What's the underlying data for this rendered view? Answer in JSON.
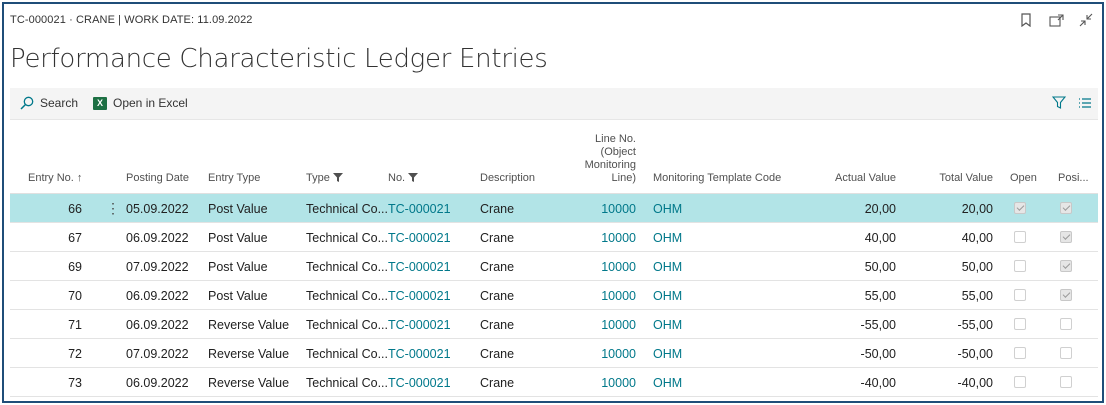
{
  "breadcrumb": "TC-000021 · CRANE | WORK DATE: 11.09.2022",
  "title": "Performance Characteristic Ledger Entries",
  "actions": {
    "search": "Search",
    "excel": "Open in Excel",
    "excel_glyph": "X"
  },
  "columns": {
    "entry_no": "Entry No. ↑",
    "posting_date": "Posting Date",
    "entry_type": "Entry Type",
    "type": "Type",
    "no": "No.",
    "description": "Description",
    "line_no_1": "Line No.",
    "line_no_2": "(Object",
    "line_no_3": "Monitoring",
    "line_no_4": "Line)",
    "template": "Monitoring Template Code",
    "actual": "Actual Value",
    "total": "Total Value",
    "open": "Open",
    "posi": "Posi..."
  },
  "rows": [
    {
      "entry_no": "66",
      "posting_date": "05.09.2022",
      "entry_type": "Post Value",
      "type": "Technical Co...",
      "no": "TC-000021",
      "description": "Crane",
      "line_no": "10000",
      "template": "OHM",
      "actual": "20,00",
      "total": "20,00",
      "open": true,
      "posi": true
    },
    {
      "entry_no": "67",
      "posting_date": "06.09.2022",
      "entry_type": "Post Value",
      "type": "Technical Co...",
      "no": "TC-000021",
      "description": "Crane",
      "line_no": "10000",
      "template": "OHM",
      "actual": "40,00",
      "total": "40,00",
      "open": false,
      "posi": true
    },
    {
      "entry_no": "69",
      "posting_date": "07.09.2022",
      "entry_type": "Post Value",
      "type": "Technical Co...",
      "no": "TC-000021",
      "description": "Crane",
      "line_no": "10000",
      "template": "OHM",
      "actual": "50,00",
      "total": "50,00",
      "open": false,
      "posi": true
    },
    {
      "entry_no": "70",
      "posting_date": "06.09.2022",
      "entry_type": "Post Value",
      "type": "Technical Co...",
      "no": "TC-000021",
      "description": "Crane",
      "line_no": "10000",
      "template": "OHM",
      "actual": "55,00",
      "total": "55,00",
      "open": false,
      "posi": true
    },
    {
      "entry_no": "71",
      "posting_date": "06.09.2022",
      "entry_type": "Reverse Value",
      "type": "Technical Co...",
      "no": "TC-000021",
      "description": "Crane",
      "line_no": "10000",
      "template": "OHM",
      "actual": "-55,00",
      "total": "-55,00",
      "open": false,
      "posi": false
    },
    {
      "entry_no": "72",
      "posting_date": "07.09.2022",
      "entry_type": "Reverse Value",
      "type": "Technical Co...",
      "no": "TC-000021",
      "description": "Crane",
      "line_no": "10000",
      "template": "OHM",
      "actual": "-50,00",
      "total": "-50,00",
      "open": false,
      "posi": false
    },
    {
      "entry_no": "73",
      "posting_date": "06.09.2022",
      "entry_type": "Reverse Value",
      "type": "Technical Co...",
      "no": "TC-000021",
      "description": "Crane",
      "line_no": "10000",
      "template": "OHM",
      "actual": "-40,00",
      "total": "-40,00",
      "open": false,
      "posi": false
    }
  ],
  "selected_row_index": 0,
  "row_menu_glyph": "⋮",
  "colors": {
    "frame": "#1f4e79",
    "link": "#00788a",
    "selected_row": "#b2e4e7",
    "excel": "#1d7044"
  }
}
